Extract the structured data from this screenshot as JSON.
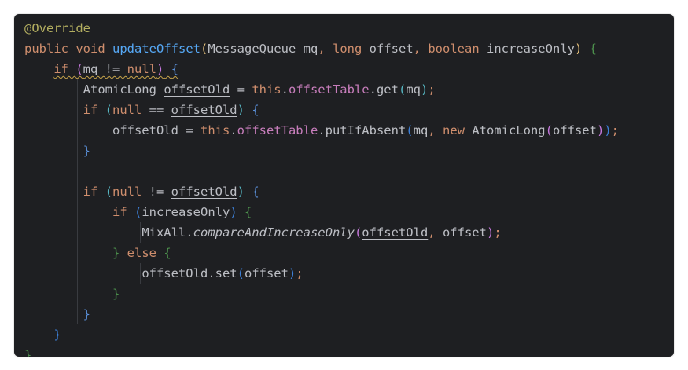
{
  "editor": {
    "language": "Java",
    "theme": "dark",
    "background": "#1e1f22",
    "lines": [
      {
        "indent": 0,
        "tokens": [
          {
            "text": "@Override",
            "cls": "c-annotation"
          }
        ]
      },
      {
        "indent": 0,
        "tokens": [
          {
            "text": "public ",
            "cls": "c-keyword"
          },
          {
            "text": "void ",
            "cls": "c-keyword"
          },
          {
            "text": "updateOffset",
            "cls": "c-method"
          },
          {
            "text": "(",
            "cls": "b1"
          },
          {
            "text": "MessageQueue mq",
            "cls": ""
          },
          {
            "text": ", ",
            "cls": "c-keyword"
          },
          {
            "text": "long ",
            "cls": "c-keyword"
          },
          {
            "text": "offset",
            "cls": ""
          },
          {
            "text": ", ",
            "cls": "c-keyword"
          },
          {
            "text": "boolean ",
            "cls": "c-keyword"
          },
          {
            "text": "increaseOnly",
            "cls": ""
          },
          {
            "text": ") ",
            "cls": "b1"
          },
          {
            "text": "{",
            "cls": "b5"
          }
        ]
      },
      {
        "indent": 1,
        "tokens": [
          {
            "text": "if ",
            "cls": "c-keyword c-warn"
          },
          {
            "text": "(",
            "cls": "b2 c-warn"
          },
          {
            "text": "mq != ",
            "cls": "c-warn"
          },
          {
            "text": "null",
            "cls": "c-keyword c-warn"
          },
          {
            "text": ")",
            "cls": "b2 c-warn"
          },
          {
            "text": " ",
            "cls": "c-warn"
          },
          {
            "text": "{",
            "cls": "b4 c-warn"
          }
        ]
      },
      {
        "indent": 2,
        "tokens": [
          {
            "text": "AtomicLong ",
            "cls": ""
          },
          {
            "text": "offsetOld",
            "cls": "c-underline"
          },
          {
            "text": " = ",
            "cls": ""
          },
          {
            "text": "this",
            "cls": "c-keyword"
          },
          {
            "text": ".",
            "cls": ""
          },
          {
            "text": "offsetTable",
            "cls": "c-field"
          },
          {
            "text": ".get",
            "cls": ""
          },
          {
            "text": "(",
            "cls": "b3"
          },
          {
            "text": "mq",
            "cls": ""
          },
          {
            "text": ")",
            "cls": "b3"
          },
          {
            "text": ";",
            "cls": "c-keyword"
          }
        ]
      },
      {
        "indent": 2,
        "tokens": [
          {
            "text": "if ",
            "cls": "c-keyword"
          },
          {
            "text": "(",
            "cls": "b3"
          },
          {
            "text": "null",
            "cls": "c-keyword"
          },
          {
            "text": " == ",
            "cls": ""
          },
          {
            "text": "offsetOld",
            "cls": "c-underline"
          },
          {
            "text": ")",
            "cls": "b3"
          },
          {
            "text": " ",
            "cls": ""
          },
          {
            "text": "{",
            "cls": "b4"
          }
        ]
      },
      {
        "indent": 3,
        "tokens": [
          {
            "text": "offsetOld",
            "cls": "c-underline"
          },
          {
            "text": " = ",
            "cls": ""
          },
          {
            "text": "this",
            "cls": "c-keyword"
          },
          {
            "text": ".",
            "cls": ""
          },
          {
            "text": "offsetTable",
            "cls": "c-field"
          },
          {
            "text": ".putIfAbsent",
            "cls": ""
          },
          {
            "text": "(",
            "cls": "b6"
          },
          {
            "text": "mq",
            "cls": ""
          },
          {
            "text": ", ",
            "cls": "c-keyword"
          },
          {
            "text": "new ",
            "cls": "c-keyword"
          },
          {
            "text": "AtomicLong",
            "cls": ""
          },
          {
            "text": "(",
            "cls": "b2"
          },
          {
            "text": "offset",
            "cls": ""
          },
          {
            "text": ")",
            "cls": "b2"
          },
          {
            "text": ")",
            "cls": "b6"
          },
          {
            "text": ";",
            "cls": "c-keyword"
          }
        ]
      },
      {
        "indent": 2,
        "tokens": [
          {
            "text": "}",
            "cls": "b4"
          }
        ]
      },
      {
        "indent": 2,
        "tokens": []
      },
      {
        "indent": 2,
        "tokens": [
          {
            "text": "if ",
            "cls": "c-keyword"
          },
          {
            "text": "(",
            "cls": "b3"
          },
          {
            "text": "null",
            "cls": "c-keyword"
          },
          {
            "text": " != ",
            "cls": ""
          },
          {
            "text": "offsetOld",
            "cls": "c-underline"
          },
          {
            "text": ")",
            "cls": "b3"
          },
          {
            "text": " ",
            "cls": ""
          },
          {
            "text": "{",
            "cls": "b4"
          }
        ]
      },
      {
        "indent": 3,
        "tokens": [
          {
            "text": "if ",
            "cls": "c-keyword"
          },
          {
            "text": "(",
            "cls": "b6"
          },
          {
            "text": "increaseOnly",
            "cls": ""
          },
          {
            "text": ")",
            "cls": "b6"
          },
          {
            "text": " ",
            "cls": ""
          },
          {
            "text": "{",
            "cls": "b5"
          }
        ]
      },
      {
        "indent": 4,
        "tokens": [
          {
            "text": "MixAll.",
            "cls": ""
          },
          {
            "text": "compareAndIncreaseOnly",
            "cls": "c-italic"
          },
          {
            "text": "(",
            "cls": "b2"
          },
          {
            "text": "offsetOld",
            "cls": "c-underline"
          },
          {
            "text": ", ",
            "cls": "c-keyword"
          },
          {
            "text": "offset",
            "cls": ""
          },
          {
            "text": ")",
            "cls": "b2"
          },
          {
            "text": ";",
            "cls": "c-keyword"
          }
        ]
      },
      {
        "indent": 3,
        "tokens": [
          {
            "text": "} ",
            "cls": "b5"
          },
          {
            "text": "else ",
            "cls": "c-keyword"
          },
          {
            "text": "{",
            "cls": "b5"
          }
        ]
      },
      {
        "indent": 4,
        "tokens": [
          {
            "text": "offsetOld",
            "cls": "c-underline"
          },
          {
            "text": ".set",
            "cls": ""
          },
          {
            "text": "(",
            "cls": "b6"
          },
          {
            "text": "offset",
            "cls": ""
          },
          {
            "text": ")",
            "cls": "b6"
          },
          {
            "text": ";",
            "cls": "c-keyword"
          }
        ]
      },
      {
        "indent": 3,
        "tokens": [
          {
            "text": "}",
            "cls": "b5"
          }
        ]
      },
      {
        "indent": 2,
        "tokens": [
          {
            "text": "}",
            "cls": "b4"
          }
        ]
      },
      {
        "indent": 1,
        "tokens": [
          {
            "text": "}",
            "cls": "b6"
          }
        ]
      },
      {
        "indent": 0,
        "tokens": [
          {
            "text": "}",
            "cls": "b5"
          }
        ]
      }
    ]
  }
}
